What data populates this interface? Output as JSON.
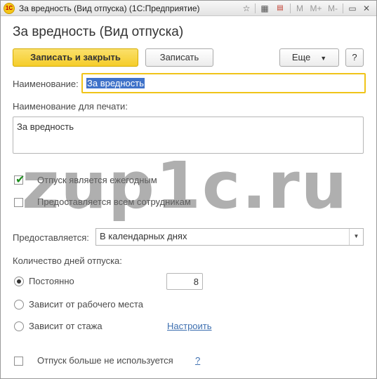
{
  "window": {
    "title": "За вредность (Вид отпуска)  (1С:Предприятие)",
    "toolbar_icons": [
      "star-icon",
      "calculator-icon",
      "calendar-icon",
      "memory-M",
      "memory-M-plus",
      "memory-M-minus",
      "minimize-icon",
      "maximize-icon",
      "close-icon"
    ],
    "memory": {
      "m": "M",
      "m_plus": "M+",
      "m_minus": "M-"
    }
  },
  "form": {
    "title": "За вредность (Вид отпуска)"
  },
  "toolbar": {
    "save_close_label": "Записать и закрыть",
    "save_label": "Записать",
    "more_label": "Еще",
    "help_label": "?"
  },
  "fields": {
    "name_label": "Наименование:",
    "name_value": "За вредность",
    "print_name_label": "Наименование для печати:",
    "print_name_value": "За вредность"
  },
  "checkboxes": {
    "annual_label": "Отпуск является ежегодным",
    "annual_checked": true,
    "all_employees_label": "Предоставляется всем сотрудникам",
    "all_employees_checked": false
  },
  "provision": {
    "label": "Предоставляется:",
    "value": "В календарных днях"
  },
  "days": {
    "section_label": "Количество дней отпуска:",
    "options": [
      {
        "label": "Постоянно",
        "selected": true
      },
      {
        "label": "Зависит от рабочего места",
        "selected": false
      },
      {
        "label": "Зависит от стажа",
        "selected": false
      }
    ],
    "constant_value": "8",
    "configure_link": "Настроить"
  },
  "unused": {
    "label": "Отпуск больше не используется",
    "checked": false,
    "help": "?"
  },
  "watermark": "zup1c.ru",
  "colors": {
    "primary_button": "#f5cd2a",
    "focus_border": "#f0c419",
    "selection": "#3f72c9",
    "check_green": "#1f8f1f",
    "link": "#3d6fb0"
  }
}
